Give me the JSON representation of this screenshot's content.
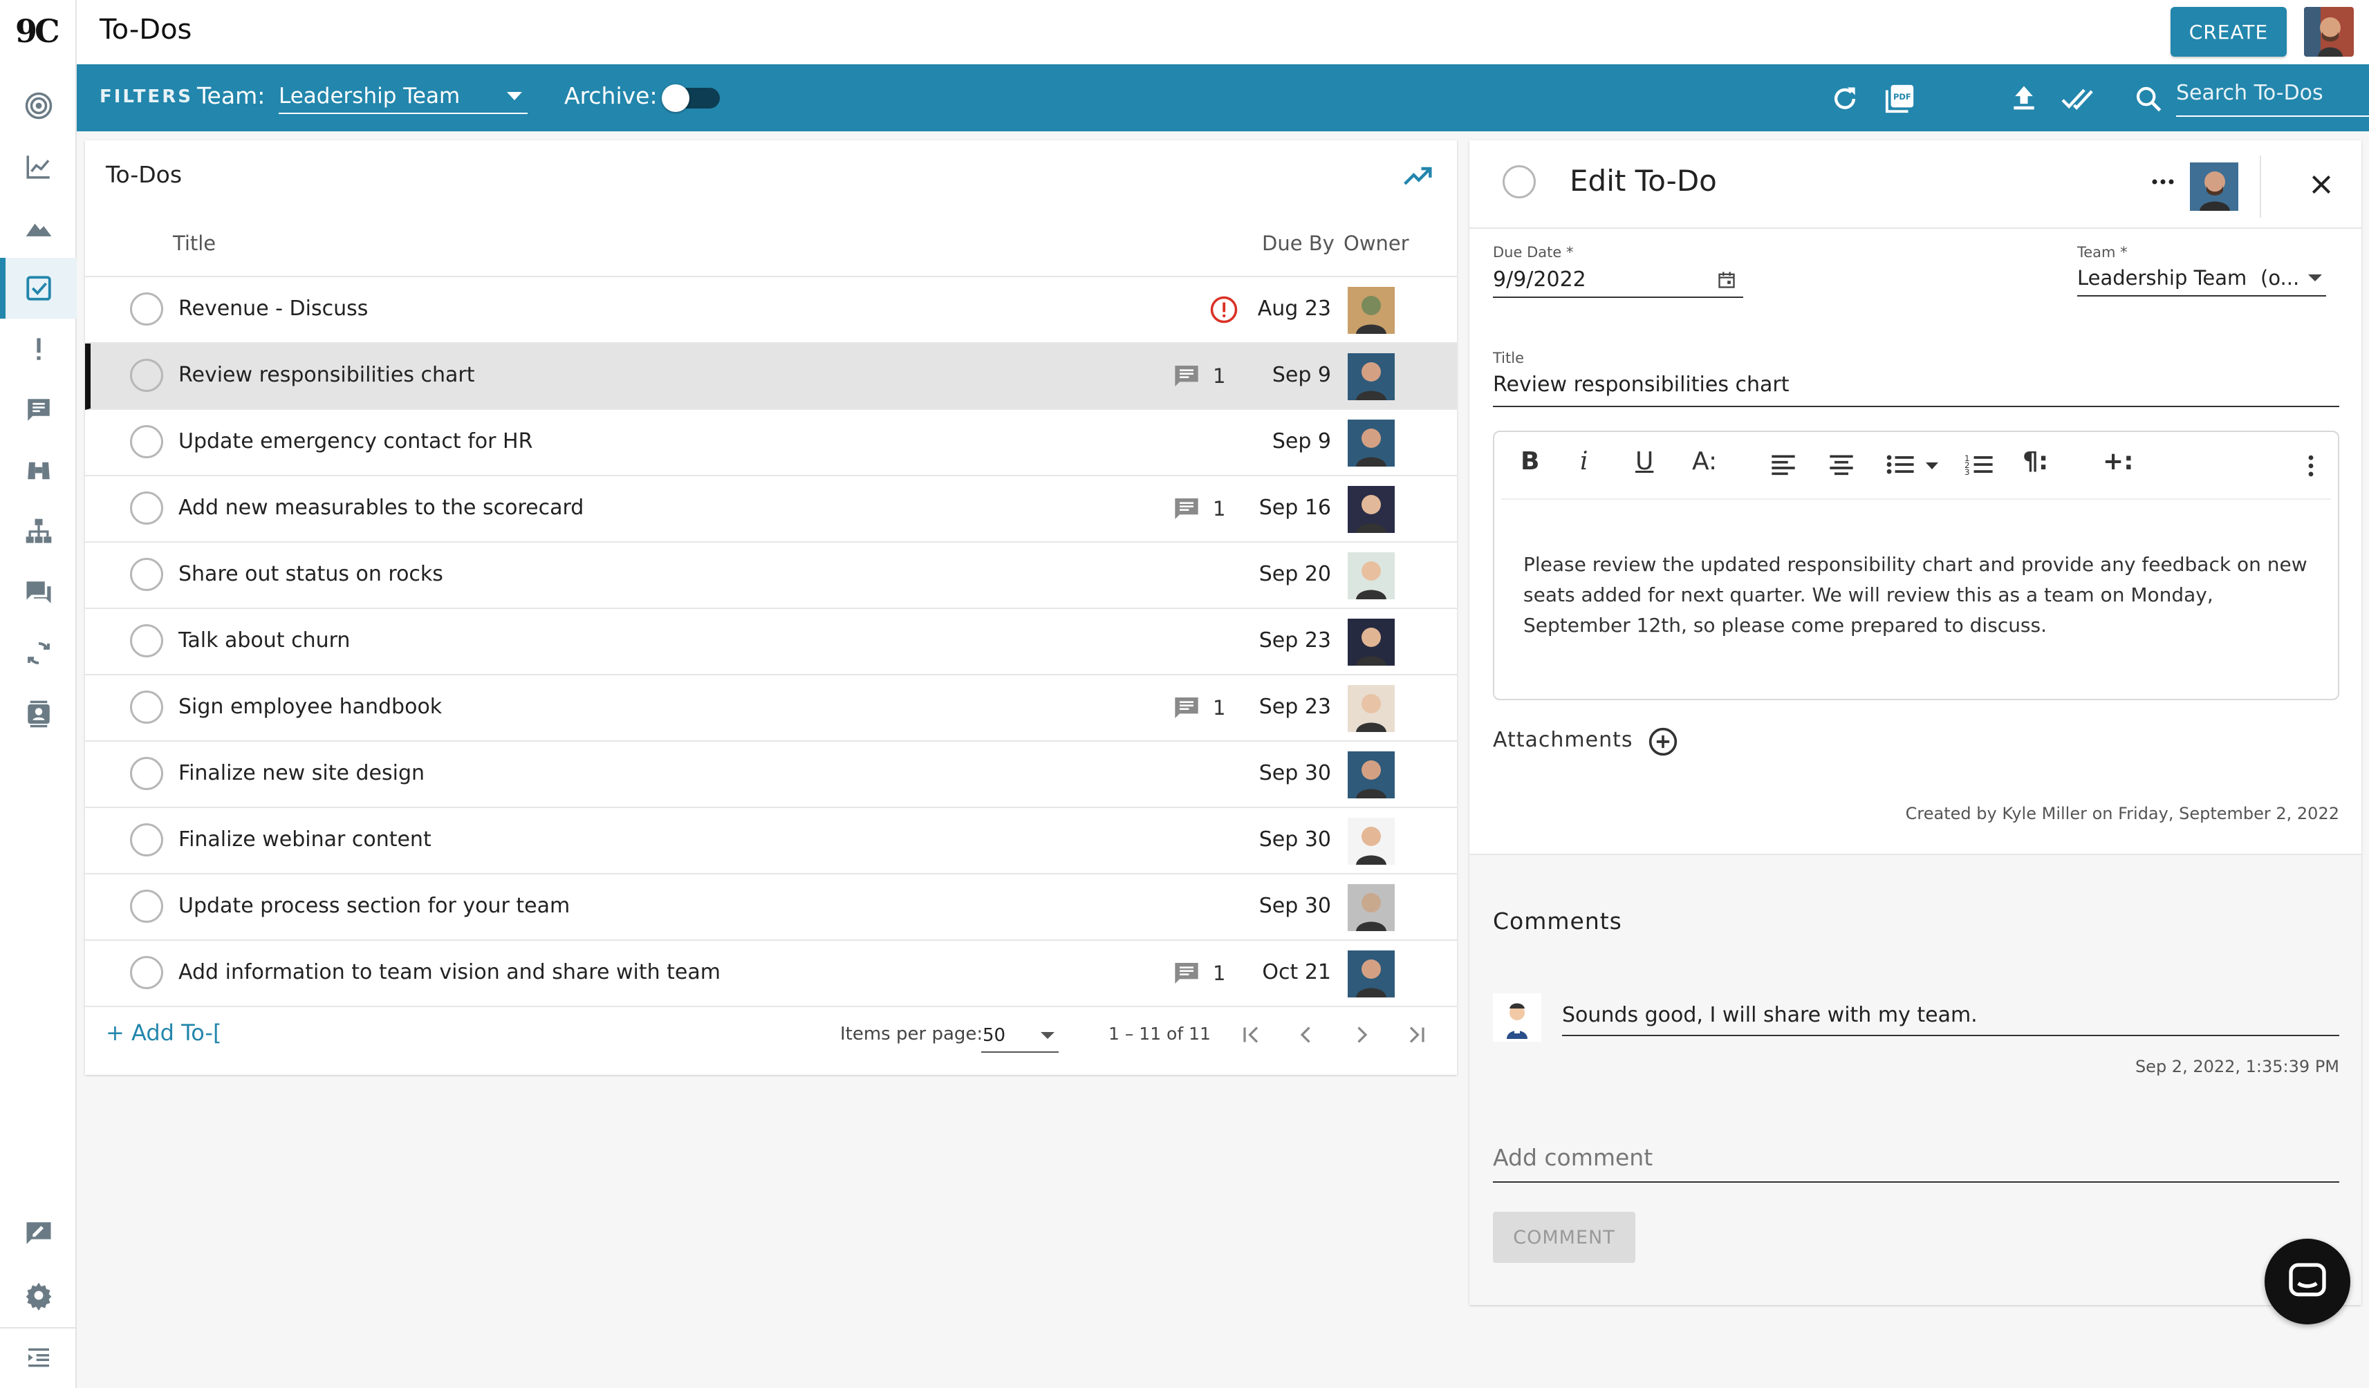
{
  "app": {
    "logo": "9C",
    "page_title": "To-Dos",
    "create_label": "CREATE"
  },
  "sidebar_icons": [
    "target-icon",
    "chart-line-icon",
    "mountain-icon",
    "checkbox-icon",
    "exclamation-icon",
    "feedback-icon",
    "binoculars-icon",
    "org-chart-icon",
    "chat-icon",
    "sync-icon",
    "contacts-icon",
    "edit-note-icon",
    "gear-icon",
    "menu-collapse-icon"
  ],
  "filters": {
    "label": "FILTERS",
    "team_label": "Team:",
    "team_value": "Leadership Team",
    "archive_label": "Archive:",
    "search_placeholder": "Search To-Dos"
  },
  "list": {
    "title": "To-Dos",
    "col_title": "Title",
    "col_due": "Due By",
    "col_owner": "Owner",
    "add_label": "+ Add To-[",
    "items_per_page_label": "Items per page:",
    "items_per_page": "50",
    "range": "1 – 11 of 11",
    "rows": [
      {
        "title": "Revenue - Discuss",
        "due": "Aug 23",
        "overdue": true,
        "comments": ""
      },
      {
        "title": "Review responsibilities chart",
        "due": "Sep 9",
        "overdue": false,
        "comments": "1"
      },
      {
        "title": "Update emergency contact for HR",
        "due": "Sep 9",
        "overdue": false,
        "comments": ""
      },
      {
        "title": "Add new measurables to the scorecard",
        "due": "Sep 16",
        "overdue": false,
        "comments": "1"
      },
      {
        "title": "Share out status on rocks",
        "due": "Sep 20",
        "overdue": false,
        "comments": ""
      },
      {
        "title": "Talk about churn",
        "due": "Sep 23",
        "overdue": false,
        "comments": ""
      },
      {
        "title": "Sign employee handbook",
        "due": "Sep 23",
        "overdue": false,
        "comments": "1"
      },
      {
        "title": "Finalize new site design",
        "due": "Sep 30",
        "overdue": false,
        "comments": ""
      },
      {
        "title": "Finalize webinar content",
        "due": "Sep 30",
        "overdue": false,
        "comments": ""
      },
      {
        "title": "Update process section for your team",
        "due": "Sep 30",
        "overdue": false,
        "comments": ""
      },
      {
        "title": "Add information to team vision and share with team",
        "due": "Oct 21",
        "overdue": false,
        "comments": "1"
      }
    ]
  },
  "edit": {
    "heading": "Edit To-Do",
    "due_label": "Due Date *",
    "due_value": "9/9/2022",
    "team_label": "Team *",
    "team_value": "Leadership Team",
    "team_suffix": "(o...",
    "title_label": "Title",
    "title_value": "Review responsibilities chart",
    "toolbar": {
      "bold": "B",
      "italic": "i",
      "underline": "U",
      "font": "A:",
      "para": "¶:",
      "insert": "+:"
    },
    "notes": "Please review the updated responsibility chart and provide any feedback on new seats added for next quarter. We will review this as a team on Monday, September 12th, so please come prepared to discuss.",
    "attachments_label": "Attachments",
    "created": "Created by Kyle Miller on Friday, September 2, 2022",
    "comments_heading": "Comments",
    "comment_text": "Sounds good, I will share with my team.",
    "comment_time": "Sep 2, 2022, 1:35:39 PM",
    "add_comment_placeholder": "Add comment",
    "comment_button": "COMMENT"
  },
  "colors": {
    "brand": "#2386ac",
    "overdue": "#d93025"
  }
}
